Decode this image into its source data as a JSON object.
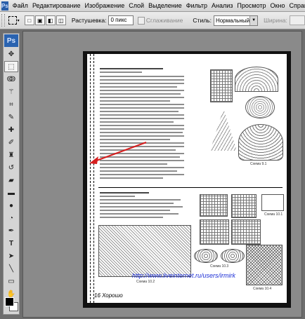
{
  "menu": {
    "app_icon": "Ps",
    "items": [
      "Файл",
      "Редактирование",
      "Изображение",
      "Слой",
      "Выделение",
      "Фильтр",
      "Анализ",
      "Просмотр",
      "Окно",
      "Справка"
    ]
  },
  "options": {
    "feather_label": "Растушевка:",
    "feather_value": "0 пикс",
    "antialias_label": "Сглаживание",
    "style_label": "Стиль:",
    "style_value": "Нормальный",
    "width_label": "Ширина:"
  },
  "toolbox": {
    "logo": "Ps",
    "tools": [
      "move-icon",
      "marquee-icon",
      "lasso-icon",
      "magic-wand-icon",
      "crop-icon",
      "eyedropper-icon",
      "healing-icon",
      "brush-icon",
      "stamp-icon",
      "history-brush-icon",
      "eraser-icon",
      "gradient-icon",
      "blur-icon",
      "dodge-icon",
      "pen-icon",
      "type-icon",
      "path-select-icon",
      "line-icon",
      "notes-icon",
      "hand-icon",
      "zoom-icon"
    ],
    "foreground_color": "#000000",
    "background_color": "#ffffff"
  },
  "document": {
    "watermark": "http://www.liveinternet.ru/users/irmirk",
    "footer": "16   Хорошо",
    "scheme_labels": [
      "Схема 9.1",
      "Схема 10.1",
      "Схема 10.2",
      "Схема 10.3",
      "Схема 10.4"
    ]
  },
  "colors": {
    "arrow": "#d61f1f",
    "watermark": "#1b2ed6"
  }
}
